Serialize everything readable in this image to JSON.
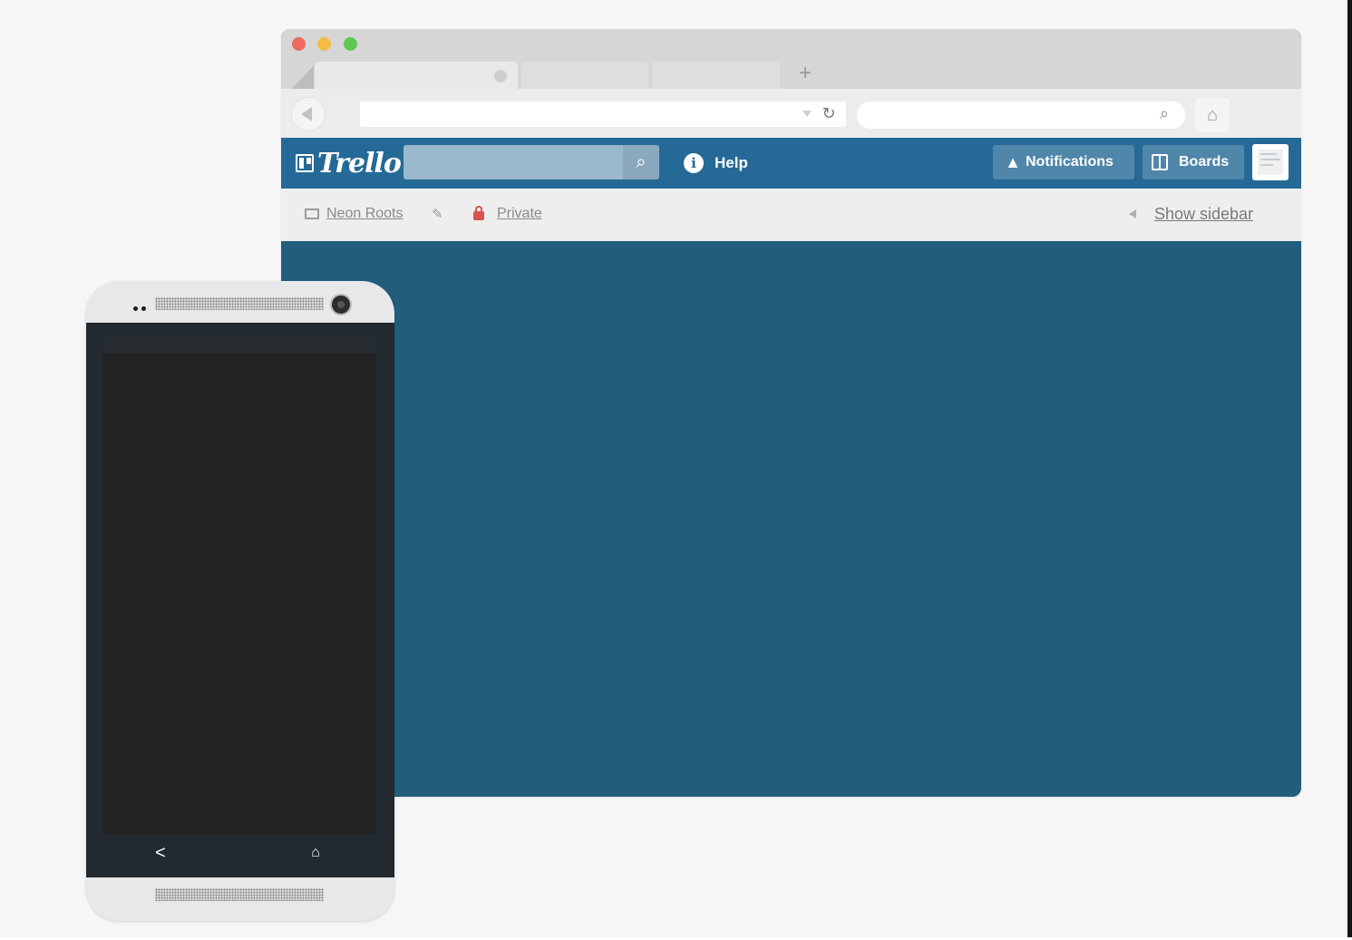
{
  "browser": {
    "tabs": [
      "",
      "",
      ""
    ],
    "new_tab_symbol": "+",
    "url_value": "",
    "search_value": ""
  },
  "trello": {
    "logo_text": "Trello",
    "search_value": "",
    "help_label": "Help",
    "info_symbol": "i",
    "notifications_label": "Notifications",
    "boards_label": "Boards",
    "colors": {
      "header": "#256a96",
      "board_background": "#225d7e"
    }
  },
  "board": {
    "organization": "Neon Roots",
    "visibility": "Private",
    "show_sidebar_label": "Show sidebar"
  },
  "icons": {
    "reload": "↻",
    "search": "⌕",
    "home": "⌂",
    "pencil": "✎",
    "bell": "🔔"
  },
  "phone": {
    "nav_back": "<",
    "nav_home": "⌂"
  }
}
